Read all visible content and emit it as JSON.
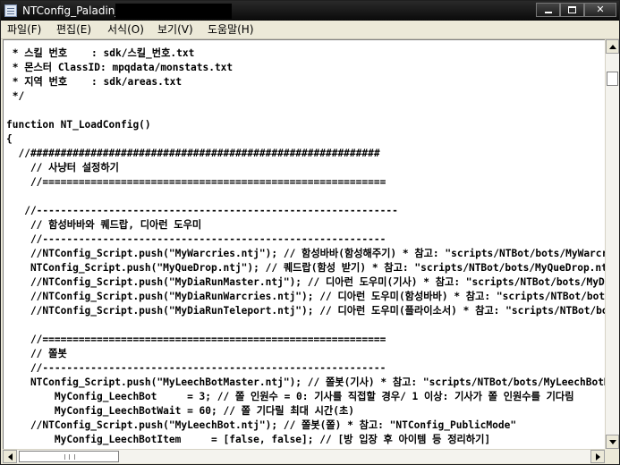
{
  "window": {
    "title": "NTConfig_Paladin_"
  },
  "menu": [
    {
      "label": "파일(F)"
    },
    {
      "label": "편집(E)"
    },
    {
      "label": "서식(O)"
    },
    {
      "label": "보기(V)"
    },
    {
      "label": "도움말(H)"
    }
  ],
  "editor": {
    "lines": [
      " * 스킬 번호    : sdk/스킬_번호.txt",
      " * 몬스터 ClassID: mpqdata/monstats.txt",
      " * 지역 번호    : sdk/areas.txt",
      " */",
      "",
      "function NT_LoadConfig()",
      "{",
      "  //##########################################################",
      "    // 사냥터 설정하기",
      "    //=========================================================",
      "",
      "   //------------------------------------------------------------",
      "    // 함성바바와 퀘드랍, 디아런 도우미",
      "    //---------------------------------------------------------",
      "    //NTConfig_Script.push(\"MyWarcries.ntj\"); // 함성바바(함성해주기) * 참고: \"scripts/NTBot/bots/MyWarcries.ntj\"",
      "    NTConfig_Script.push(\"MyQueDrop.ntj\"); // 퀘드랍(함성 받기) * 참고: \"scripts/NTBot/bots/MyQueDrop.ntj\"",
      "    //NTConfig_Script.push(\"MyDiaRunMaster.ntj\"); // 디아런 도우미(기사) * 참고: \"scripts/NTBot/bots/MyDiaRunMaster.ntj\"",
      "    //NTConfig_Script.push(\"MyDiaRunWarcries.ntj\"); // 디아런 도우미(함성바바) * 참고: \"scripts/NTBot/bots/MyDiaRunWarcries.ntj\"",
      "    //NTConfig_Script.push(\"MyDiaRunTeleport.ntj\"); // 디아런 도우미(플라이소서) * 참고: \"scripts/NTBot/bots/MyDiaRunTeleport.ntj\"",
      "",
      "    //=========================================================",
      "    // 쫄봇",
      "    //---------------------------------------------------------",
      "    NTConfig_Script.push(\"MyLeechBotMaster.ntj\"); // 쫄봇(기사) * 참고: \"scripts/NTBot/bots/MyLeechBotMaster.ntj\"",
      "        MyConfig_LeechBot     = 3; // 쫄 인원수 = 0: 기사를 직접할 경우/ 1 이상: 기사가 쫄 인원수를 기다림",
      "        MyConfig_LeechBotWait = 60; // 쫄 기다릴 최대 시간(초)",
      "    //NTConfig_Script.push(\"MyLeechBot.ntj\"); // 쫄봇(쫄) * 참고: \"NTConfig_PublicMode\"",
      "        MyConfig_LeechBotItem     = [false, false]; // [방 입장 후 아이템 등 정리하기]"
    ]
  }
}
